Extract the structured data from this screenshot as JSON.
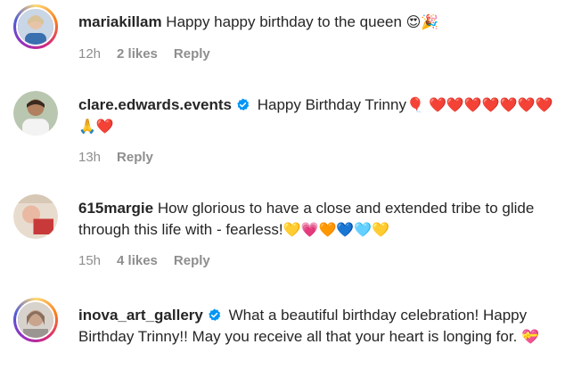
{
  "comments": [
    {
      "username": "mariakillam",
      "verified": false,
      "text": "Happy happy birthday to the queen",
      "emoji": "😍🎉",
      "time": "12h",
      "likes": "2 likes",
      "reply": "Reply"
    },
    {
      "username": "clare.edwards.events",
      "verified": true,
      "text": "Happy Birthday Trinny",
      "emoji": "🎈 ❤️❤️❤️❤️❤️❤️❤️🙏❤️",
      "time": "13h",
      "likes": "",
      "reply": "Reply"
    },
    {
      "username": "615margie",
      "verified": false,
      "text": "How glorious to have a close and extended tribe to glide through this life with - fearless!",
      "emoji": "💛💗🧡💙🩵💛",
      "time": "15h",
      "likes": "4 likes",
      "reply": "Reply"
    },
    {
      "username": "inova_art_gallery",
      "verified": true,
      "text": "What a beautiful birthday celebration! Happy Birthday Trinny!! May you receive all that your heart is longing for.",
      "emoji": "💝",
      "time": "",
      "likes": "",
      "reply": ""
    }
  ],
  "colors": {
    "text": "#262626",
    "meta": "#8e8e8e",
    "verified": "#0095f6"
  }
}
